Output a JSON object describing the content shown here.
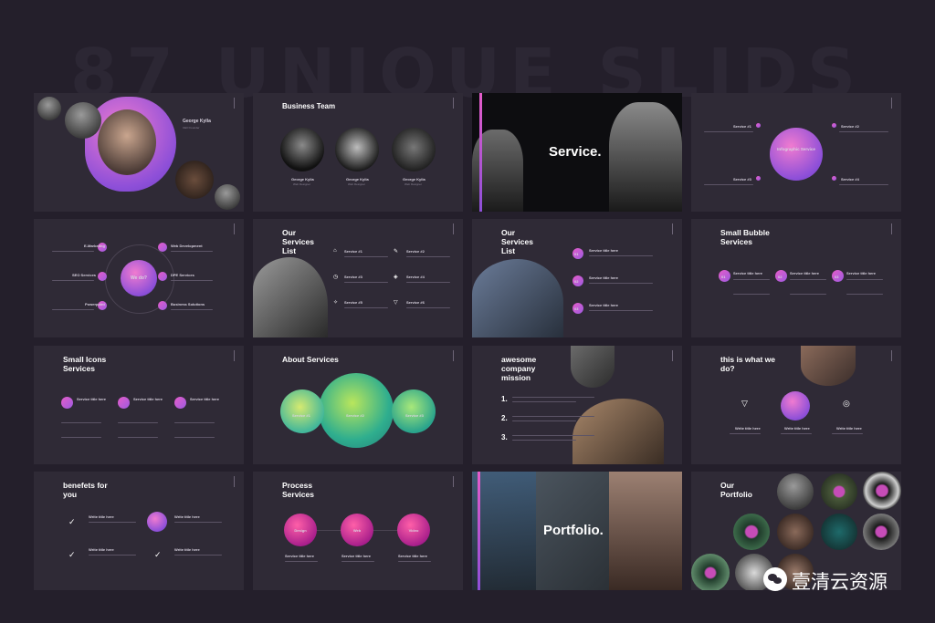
{
  "background_title": "87 UNIQUE SLIDS",
  "slides": {
    "s1": {
      "name": "George Kylla",
      "role": "CEO Founder"
    },
    "s2": {
      "title": "Business Team",
      "members": [
        {
          "name": "George Kylla",
          "role": "Web Designer"
        },
        {
          "name": "George Kylla",
          "role": "Web Designer"
        },
        {
          "name": "George Kylla",
          "role": "Web Designer"
        }
      ]
    },
    "s3": {
      "title": "Service."
    },
    "s4": {
      "center": "Infographic Service",
      "items": [
        "Service #1",
        "Service #2",
        "Service #3",
        "Service #4"
      ]
    },
    "s5": {
      "center": "We do?",
      "items": [
        "E-Marketing",
        "Web Development",
        "SEO Services",
        "DPE Services",
        "Powerpoint",
        "Business Solutions"
      ]
    },
    "s6": {
      "title": "Our Services List",
      "items": [
        "Service #1",
        "Service #2",
        "Service #3",
        "Service #4",
        "Service #5",
        "Service #6"
      ]
    },
    "s7": {
      "title": "Our Services List",
      "items": [
        {
          "num": "01",
          "label": "Service title here"
        },
        {
          "num": "02",
          "label": "Service title here"
        },
        {
          "num": "03",
          "label": "Service title here"
        }
      ]
    },
    "s8": {
      "title": "Small Bubble Services",
      "items": [
        {
          "num": "01",
          "label": "Service title here"
        },
        {
          "num": "02",
          "label": "Service title here"
        },
        {
          "num": "03",
          "label": "Service title here"
        }
      ]
    },
    "s9": {
      "title": "Small Icons Services",
      "items": [
        "Service title here",
        "Service title here",
        "Service title here"
      ]
    },
    "s10": {
      "title": "About Services",
      "circles": [
        "Service #1",
        "Service #2",
        "Service #3"
      ]
    },
    "s11": {
      "title": "awesome company mission",
      "nums": [
        "1.",
        "2.",
        "3."
      ]
    },
    "s12": {
      "title": "this is what we do?",
      "items": [
        "Write title here",
        "Write title here",
        "Write title here"
      ]
    },
    "s13": {
      "title": "benefets for you",
      "items": [
        "Write title here",
        "Write title here",
        "Write title here",
        "Write title here"
      ]
    },
    "s14": {
      "title": "Process Services",
      "steps": [
        "Design",
        "Web",
        "Video"
      ],
      "labels": [
        "Service title here",
        "Service title here",
        "Service title here"
      ]
    },
    "s15": {
      "title": "Portfolio."
    },
    "s16": {
      "title": "Our Portfolio"
    }
  },
  "watermark": {
    "text": "壹清云资源",
    "icon": "wechat-icon"
  },
  "colors": {
    "background": "#241f2b",
    "slide": "#2f2a36",
    "accent_pink": "#e55cc9",
    "accent_purple": "#8d4fd8"
  }
}
